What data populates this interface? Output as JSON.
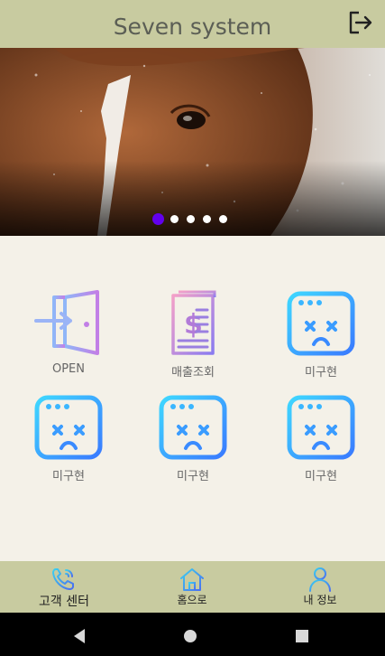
{
  "app_bar": {
    "title": "Seven system",
    "logout_icon": "logout-icon"
  },
  "banner": {
    "image": "horse-photo",
    "active_slide": 1,
    "slide_count": 5,
    "active_color": "#6200ee",
    "dot_color": "#ffffff"
  },
  "menu": {
    "items": [
      {
        "label": "OPEN",
        "icon": "door-open-icon"
      },
      {
        "label": "매출조회",
        "icon": "receipt-icon"
      },
      {
        "label": "미구현",
        "icon": "not-implemented-icon"
      },
      {
        "label": "미구현",
        "icon": "not-implemented-icon"
      },
      {
        "label": "미구현",
        "icon": "not-implemented-icon"
      },
      {
        "label": "미구현",
        "icon": "not-implemented-icon"
      }
    ]
  },
  "bottom_nav": {
    "items": [
      {
        "label": "고객 센터",
        "icon": "phone-icon",
        "active": true
      },
      {
        "label": "홈으로",
        "icon": "home-icon",
        "active": false
      },
      {
        "label": "내 정보",
        "icon": "person-icon",
        "active": false
      }
    ]
  },
  "system_nav": {
    "back": "back-icon",
    "home": "home-circle-icon",
    "recents": "recents-icon"
  }
}
